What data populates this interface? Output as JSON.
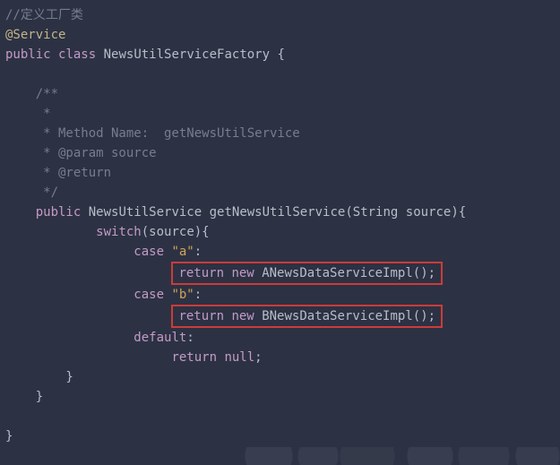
{
  "code": {
    "line1": "//定义工厂类",
    "line2": "@Service",
    "line3_kw1": "public",
    "line3_kw2": "class",
    "line3_name": "NewsUtilServiceFactory",
    "line3_brace": "{",
    "doc1": "    /**",
    "doc2": "     *",
    "doc3": "     * Method Name:  getNewsUtilService",
    "doc4": "     * @param source",
    "doc5": "     * @return",
    "doc6": "     */",
    "m_kw1": "public",
    "m_ret": "NewsUtilService",
    "m_name": "getNewsUtilService",
    "m_param_open": "(",
    "m_param_type": "String",
    "m_param_name": "source",
    "m_param_close_brace": "){",
    "sw_kw": "switch",
    "sw_expr_open": "(",
    "sw_expr": "source",
    "sw_expr_close": "){",
    "case_kw": "case",
    "case_a_val": "\"a\"",
    "case_colon": ":",
    "ret_kw": "return",
    "new_kw": "new",
    "impl_a": "ANewsDataServiceImpl",
    "call_close": "();",
    "case_b_val": "\"b\"",
    "impl_b": "BNewsDataServiceImpl",
    "default_kw": "default",
    "default_colon": ":",
    "ret_null_kw": "return",
    "ret_null_val": "null",
    "semi": ";",
    "close_brace_inner": "        }",
    "close_brace_method": "    }",
    "close_brace_class": "}"
  }
}
